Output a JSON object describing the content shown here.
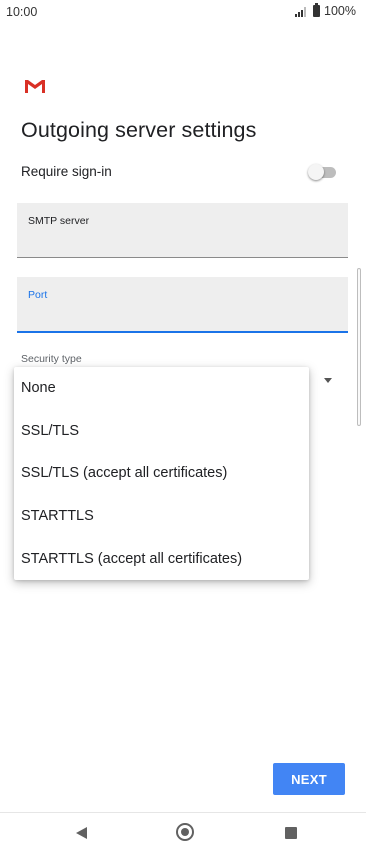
{
  "status_bar": {
    "time": "10:00",
    "battery": "100%",
    "icons": [
      "signal-icon",
      "battery-icon"
    ]
  },
  "app": {
    "logo": "gmail-logo-icon",
    "brand_color": "#d93025"
  },
  "page": {
    "title": "Outgoing server settings"
  },
  "require_signin": {
    "label": "Require sign-in",
    "enabled": false
  },
  "smtp_field": {
    "label": "SMTP server",
    "value": ""
  },
  "port_field": {
    "label": "Port",
    "value": "",
    "focused": true,
    "accent": "#1a73e8"
  },
  "security": {
    "label": "Security type",
    "options": [
      "None",
      "SSL/TLS",
      "SSL/TLS (accept all certificates)",
      "STARTTLS",
      "STARTTLS (accept all certificates)"
    ]
  },
  "actions": {
    "next_label": "NEXT",
    "next_color": "#4285f4"
  },
  "nav": {
    "icons": [
      "back-icon",
      "home-icon",
      "recents-icon"
    ]
  }
}
